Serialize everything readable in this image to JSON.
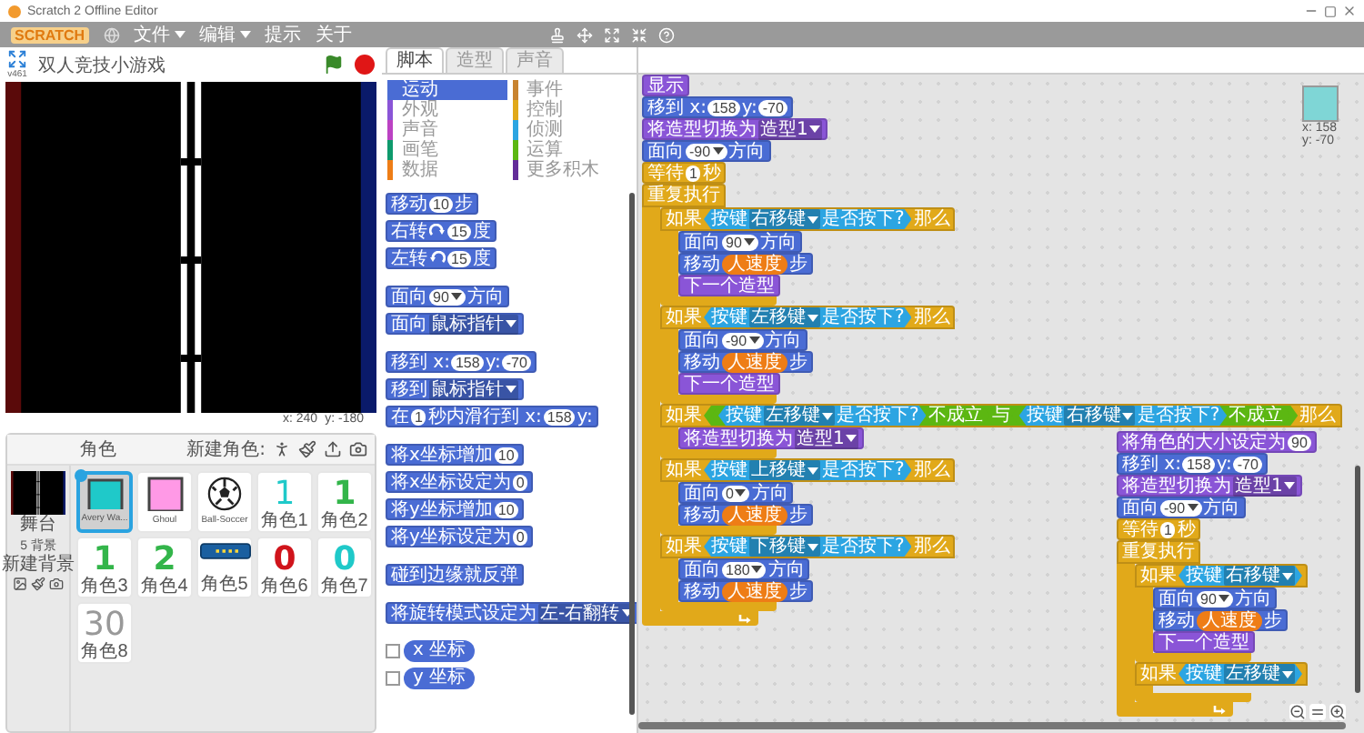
{
  "window": {
    "title": "Scratch 2 Offline Editor"
  },
  "menubar": {
    "logo": "SCRATCH",
    "menus": [
      {
        "label": "文件",
        "dropdown": true
      },
      {
        "label": "编辑",
        "dropdown": true
      },
      {
        "label": "提示",
        "dropdown": false
      },
      {
        "label": "关于",
        "dropdown": false
      }
    ]
  },
  "stage": {
    "version": "v461",
    "title": "双人竞技小游戏",
    "coords": [
      {
        "label": "x:",
        "value": "240"
      },
      {
        "label": "y:",
        "value": "-180"
      }
    ]
  },
  "sprites": {
    "title": "角色",
    "new_label": "新建角色:",
    "stage_item": {
      "name": "舞台",
      "backdrops": "5 背景",
      "new_backdrop": "新建背景"
    },
    "items": [
      {
        "name": "Avery Wa...",
        "selected": true,
        "kind": "square",
        "color": "#1fc9c9"
      },
      {
        "name": "Ghoul",
        "selected": false,
        "kind": "square",
        "color": "#ff99e6"
      },
      {
        "name": "Ball-Soccer",
        "selected": false,
        "kind": "ball",
        "color": "#222222"
      },
      {
        "name": "角色1",
        "selected": false,
        "kind": "outline-glyph",
        "glyph": "1",
        "color": "#1fc9c9"
      },
      {
        "name": "角色2",
        "selected": false,
        "kind": "glyph",
        "glyph": "1",
        "color": "#33b54a"
      },
      {
        "name": "角色3",
        "selected": false,
        "kind": "glyph",
        "glyph": "1",
        "color": "#33b54a"
      },
      {
        "name": "角色4",
        "selected": false,
        "kind": "glyph",
        "glyph": "2",
        "color": "#33b54a"
      },
      {
        "name": "角色5",
        "selected": false,
        "kind": "bar",
        "color": "#1a5fa0"
      },
      {
        "name": "角色6",
        "selected": false,
        "kind": "glyph",
        "glyph": "0",
        "color": "#d0141b"
      },
      {
        "name": "角色7",
        "selected": false,
        "kind": "glyph",
        "glyph": "0",
        "color": "#1fc9c9"
      },
      {
        "name": "角色8",
        "selected": false,
        "kind": "outline-glyph",
        "glyph": "30",
        "color": "#999999"
      }
    ]
  },
  "palette": {
    "tabs": [
      {
        "label": "脚本",
        "selected": true
      },
      {
        "label": "造型",
        "selected": false
      },
      {
        "label": "声音",
        "selected": false
      }
    ],
    "categories": [
      {
        "label": "运动",
        "color": "#4a6cd4",
        "selected": true
      },
      {
        "label": "事件",
        "color": "#c88330",
        "selected": false
      },
      {
        "label": "外观",
        "color": "#8a55d7",
        "selected": false
      },
      {
        "label": "控制",
        "color": "#e1a91a",
        "selected": false
      },
      {
        "label": "声音",
        "color": "#bb42c3",
        "selected": false
      },
      {
        "label": "侦测",
        "color": "#2ca5e2",
        "selected": false
      },
      {
        "label": "画笔",
        "color": "#0e9a6c",
        "selected": false
      },
      {
        "label": "运算",
        "color": "#5cb712",
        "selected": false
      },
      {
        "label": "数据",
        "color": "#ee7d16",
        "selected": false
      },
      {
        "label": "更多积木",
        "color": "#632d99",
        "selected": false
      }
    ],
    "block_groups": [
      [
        {
          "kind": "motion",
          "parts": [
            {
              "kind": "label",
              "text": "移动"
            },
            {
              "kind": "num",
              "text": "10"
            },
            {
              "kind": "label",
              "text": "步"
            }
          ]
        },
        {
          "kind": "motion",
          "parts": [
            {
              "kind": "label",
              "text": "右转"
            },
            {
              "kind": "cw"
            },
            {
              "kind": "num",
              "text": "15"
            },
            {
              "kind": "label",
              "text": "度"
            }
          ]
        },
        {
          "kind": "motion",
          "parts": [
            {
              "kind": "label",
              "text": "左转"
            },
            {
              "kind": "ccw"
            },
            {
              "kind": "num",
              "text": "15"
            },
            {
              "kind": "label",
              "text": "度"
            }
          ]
        }
      ],
      [
        {
          "kind": "motion",
          "parts": [
            {
              "kind": "label",
              "text": "面向"
            },
            {
              "kind": "angle",
              "text": "90"
            },
            {
              "kind": "label",
              "text": "方向"
            }
          ]
        },
        {
          "kind": "motion",
          "parts": [
            {
              "kind": "label",
              "text": "面向"
            },
            {
              "kind": "menu",
              "text": "鼠标指针"
            }
          ]
        }
      ],
      [
        {
          "kind": "motion",
          "parts": [
            {
              "kind": "label",
              "text": "移到 x:"
            },
            {
              "kind": "num",
              "text": "158"
            },
            {
              "kind": "label",
              "text": "y:"
            },
            {
              "kind": "num",
              "text": "-70"
            }
          ]
        },
        {
          "kind": "motion",
          "parts": [
            {
              "kind": "label",
              "text": "移到"
            },
            {
              "kind": "menu",
              "text": "鼠标指针"
            }
          ]
        },
        {
          "kind": "motion",
          "parts": [
            {
              "kind": "label",
              "text": "在"
            },
            {
              "kind": "num",
              "text": "1"
            },
            {
              "kind": "label",
              "text": "秒内滑行到 x:"
            },
            {
              "kind": "num",
              "text": "158"
            },
            {
              "kind": "label",
              "text": "y:"
            }
          ]
        }
      ],
      [
        {
          "kind": "motion",
          "parts": [
            {
              "kind": "label",
              "text": "将x坐标增加"
            },
            {
              "kind": "num",
              "text": "10"
            }
          ]
        },
        {
          "kind": "motion",
          "parts": [
            {
              "kind": "label",
              "text": "将x坐标设定为"
            },
            {
              "kind": "num",
              "text": "0"
            }
          ]
        },
        {
          "kind": "motion",
          "parts": [
            {
              "kind": "label",
              "text": "将y坐标增加"
            },
            {
              "kind": "num",
              "text": "10"
            }
          ]
        },
        {
          "kind": "motion",
          "parts": [
            {
              "kind": "label",
              "text": "将y坐标设定为"
            },
            {
              "kind": "num",
              "text": "0"
            }
          ]
        }
      ],
      [
        {
          "kind": "motion",
          "parts": [
            {
              "kind": "label",
              "text": "碰到边缘就反弹"
            }
          ]
        }
      ],
      [
        {
          "kind": "motion",
          "parts": [
            {
              "kind": "label",
              "text": "将旋转模式设定为"
            },
            {
              "kind": "menu",
              "text": "左-右翻转"
            }
          ]
        }
      ]
    ],
    "reporters": [
      {
        "label": "x 坐标",
        "checked": false
      },
      {
        "label": "y 坐标",
        "checked": false
      }
    ]
  },
  "scripts": {
    "sprite_info": {
      "x": "x: 158",
      "y": "y: -70"
    },
    "stacks": [
      [
        {
          "kind": "looks",
          "parts": [
            {
              "kind": "label",
              "text": "显示"
            }
          ]
        },
        {
          "kind": "motion",
          "parts": [
            {
              "kind": "label",
              "text": "移到 x:"
            },
            {
              "kind": "num",
              "text": "158"
            },
            {
              "kind": "label",
              "text": "y:"
            },
            {
              "kind": "num",
              "text": "-70"
            }
          ]
        },
        {
          "kind": "looks",
          "parts": [
            {
              "kind": "label",
              "text": "将造型切换为"
            },
            {
              "kind": "menu",
              "text": "造型1"
            }
          ]
        },
        {
          "kind": "motion",
          "parts": [
            {
              "kind": "label",
              "text": "面向"
            },
            {
              "kind": "angle",
              "text": "-90"
            },
            {
              "kind": "label",
              "text": "方向"
            }
          ]
        },
        {
          "kind": "control",
          "parts": [
            {
              "kind": "label",
              "text": "等待"
            },
            {
              "kind": "num",
              "text": "1"
            },
            {
              "kind": "label",
              "text": "秒"
            }
          ]
        },
        {
          "kind": "forever",
          "parts": [
            {
              "kind": "label",
              "text": "重复执行"
            }
          ],
          "children": [
            {
              "kind": "if",
              "parts": [
                {
                  "kind": "label",
                  "text": "如果"
                },
                {
                  "kind": "sensing",
                  "parts": [
                    {
                      "kind": "label",
                      "text": "按键"
                    },
                    {
                      "kind": "menu",
                      "text": "右移键"
                    },
                    {
                      "kind": "label",
                      "text": "是否按下?"
                    }
                  ]
                },
                {
                  "kind": "label",
                  "text": "那么"
                }
              ],
              "children": [
                {
                  "kind": "motion",
                  "parts": [
                    {
                      "kind": "label",
                      "text": "面向"
                    },
                    {
                      "kind": "angle",
                      "text": "90"
                    },
                    {
                      "kind": "label",
                      "text": "方向"
                    }
                  ]
                },
                {
                  "kind": "motion",
                  "parts": [
                    {
                      "kind": "label",
                      "text": "移动"
                    },
                    {
                      "kind": "var",
                      "text": "人速度"
                    },
                    {
                      "kind": "label",
                      "text": "步"
                    }
                  ]
                },
                {
                  "kind": "looks",
                  "parts": [
                    {
                      "kind": "label",
                      "text": "下一个造型"
                    }
                  ]
                }
              ]
            },
            {
              "kind": "if",
              "parts": [
                {
                  "kind": "label",
                  "text": "如果"
                },
                {
                  "kind": "sensing",
                  "parts": [
                    {
                      "kind": "label",
                      "text": "按键"
                    },
                    {
                      "kind": "menu",
                      "text": "左移键"
                    },
                    {
                      "kind": "label",
                      "text": "是否按下?"
                    }
                  ]
                },
                {
                  "kind": "label",
                  "text": "那么"
                }
              ],
              "children": [
                {
                  "kind": "motion",
                  "parts": [
                    {
                      "kind": "label",
                      "text": "面向"
                    },
                    {
                      "kind": "angle",
                      "text": "-90"
                    },
                    {
                      "kind": "label",
                      "text": "方向"
                    }
                  ]
                },
                {
                  "kind": "motion",
                  "parts": [
                    {
                      "kind": "label",
                      "text": "移动"
                    },
                    {
                      "kind": "var",
                      "text": "人速度"
                    },
                    {
                      "kind": "label",
                      "text": "步"
                    }
                  ]
                },
                {
                  "kind": "looks",
                  "parts": [
                    {
                      "kind": "label",
                      "text": "下一个造型"
                    }
                  ]
                }
              ]
            },
            {
              "kind": "if",
              "parts": [
                {
                  "kind": "label",
                  "text": "如果"
                },
                {
                  "kind": "operator",
                  "parts": [
                    {
                      "kind": "operator",
                      "parts": [
                        {
                          "kind": "sensing",
                          "parts": [
                            {
                              "kind": "label",
                              "text": "按键"
                            },
                            {
                              "kind": "menu",
                              "text": "左移键"
                            },
                            {
                              "kind": "label",
                              "text": "是否按下?"
                            }
                          ]
                        },
                        {
                          "kind": "label",
                          "text": "不成立"
                        }
                      ]
                    },
                    {
                      "kind": "label",
                      "text": "与"
                    },
                    {
                      "kind": "operator",
                      "parts": [
                        {
                          "kind": "sensing",
                          "parts": [
                            {
                              "kind": "label",
                              "text": "按键"
                            },
                            {
                              "kind": "menu",
                              "text": "右移键"
                            },
                            {
                              "kind": "label",
                              "text": "是否按下?"
                            }
                          ]
                        },
                        {
                          "kind": "label",
                          "text": "不成立"
                        }
                      ]
                    }
                  ]
                },
                {
                  "kind": "label",
                  "text": "那么"
                }
              ],
              "children": [
                {
                  "kind": "looks",
                  "parts": [
                    {
                      "kind": "label",
                      "text": "将造型切换为"
                    },
                    {
                      "kind": "menu",
                      "text": "造型1"
                    }
                  ]
                }
              ]
            },
            {
              "kind": "if",
              "parts": [
                {
                  "kind": "label",
                  "text": "如果"
                },
                {
                  "kind": "sensing",
                  "parts": [
                    {
                      "kind": "label",
                      "text": "按键"
                    },
                    {
                      "kind": "menu",
                      "text": "上移键"
                    },
                    {
                      "kind": "label",
                      "text": "是否按下?"
                    }
                  ]
                },
                {
                  "kind": "label",
                  "text": "那么"
                }
              ],
              "children": [
                {
                  "kind": "motion",
                  "parts": [
                    {
                      "kind": "label",
                      "text": "面向"
                    },
                    {
                      "kind": "angle",
                      "text": "0"
                    },
                    {
                      "kind": "label",
                      "text": "方向"
                    }
                  ]
                },
                {
                  "kind": "motion",
                  "parts": [
                    {
                      "kind": "label",
                      "text": "移动"
                    },
                    {
                      "kind": "var",
                      "text": "人速度"
                    },
                    {
                      "kind": "label",
                      "text": "步"
                    }
                  ]
                }
              ]
            },
            {
              "kind": "if",
              "parts": [
                {
                  "kind": "label",
                  "text": "如果"
                },
                {
                  "kind": "sensing",
                  "parts": [
                    {
                      "kind": "label",
                      "text": "按键"
                    },
                    {
                      "kind": "menu",
                      "text": "下移键"
                    },
                    {
                      "kind": "label",
                      "text": "是否按下?"
                    }
                  ]
                },
                {
                  "kind": "label",
                  "text": "那么"
                }
              ],
              "children": [
                {
                  "kind": "motion",
                  "parts": [
                    {
                      "kind": "label",
                      "text": "面向"
                    },
                    {
                      "kind": "angle",
                      "text": "180"
                    },
                    {
                      "kind": "label",
                      "text": "方向"
                    }
                  ]
                },
                {
                  "kind": "motion",
                  "parts": [
                    {
                      "kind": "label",
                      "text": "移动"
                    },
                    {
                      "kind": "var",
                      "text": "人速度"
                    },
                    {
                      "kind": "label",
                      "text": "步"
                    }
                  ]
                }
              ]
            }
          ]
        }
      ],
      [
        {
          "kind": "looks",
          "parts": [
            {
              "kind": "label",
              "text": "将角色的大小设定为"
            },
            {
              "kind": "num",
              "text": "90"
            }
          ]
        },
        {
          "kind": "motion",
          "parts": [
            {
              "kind": "label",
              "text": "移到 x:"
            },
            {
              "kind": "num",
              "text": "158"
            },
            {
              "kind": "label",
              "text": "y:"
            },
            {
              "kind": "num",
              "text": "-70"
            }
          ]
        },
        {
          "kind": "looks",
          "parts": [
            {
              "kind": "label",
              "text": "将造型切换为"
            },
            {
              "kind": "menu",
              "text": "造型1"
            }
          ]
        },
        {
          "kind": "motion",
          "parts": [
            {
              "kind": "label",
              "text": "面向"
            },
            {
              "kind": "angle",
              "text": "-90"
            },
            {
              "kind": "label",
              "text": "方向"
            }
          ]
        },
        {
          "kind": "control",
          "parts": [
            {
              "kind": "label",
              "text": "等待"
            },
            {
              "kind": "num",
              "text": "1"
            },
            {
              "kind": "label",
              "text": "秒"
            }
          ]
        },
        {
          "kind": "forever",
          "parts": [
            {
              "kind": "label",
              "text": "重复执行"
            }
          ],
          "children": [
            {
              "kind": "if",
              "parts": [
                {
                  "kind": "label",
                  "text": "如果"
                },
                {
                  "kind": "sensing",
                  "parts": [
                    {
                      "kind": "label",
                      "text": "按键"
                    },
                    {
                      "kind": "menu",
                      "text": "右移键"
                    }
                  ]
                }
              ],
              "children": [
                {
                  "kind": "motion",
                  "parts": [
                    {
                      "kind": "label",
                      "text": "面向"
                    },
                    {
                      "kind": "angle",
                      "text": "90"
                    },
                    {
                      "kind": "label",
                      "text": "方向"
                    }
                  ]
                },
                {
                  "kind": "motion",
                  "parts": [
                    {
                      "kind": "label",
                      "text": "移动"
                    },
                    {
                      "kind": "var",
                      "text": "人速度"
                    },
                    {
                      "kind": "label",
                      "text": "步"
                    }
                  ]
                },
                {
                  "kind": "looks",
                  "parts": [
                    {
                      "kind": "label",
                      "text": "下一个造型"
                    }
                  ]
                }
              ]
            },
            {
              "kind": "if",
              "parts": [
                {
                  "kind": "label",
                  "text": "如果"
                },
                {
                  "kind": "sensing",
                  "parts": [
                    {
                      "kind": "label",
                      "text": "按键"
                    },
                    {
                      "kind": "menu",
                      "text": "左移键"
                    }
                  ]
                }
              ]
            }
          ]
        }
      ]
    ]
  }
}
